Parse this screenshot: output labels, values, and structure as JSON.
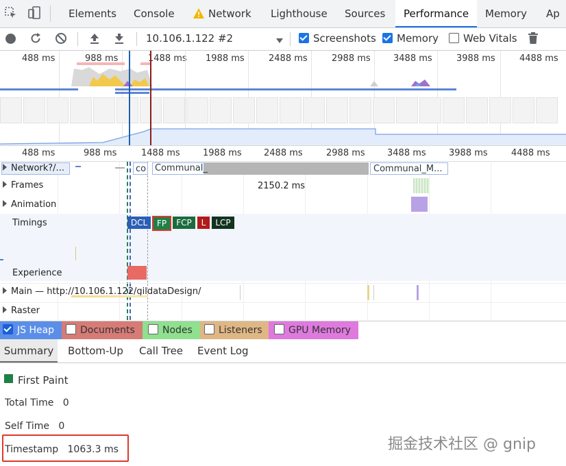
{
  "tabs": [
    "Elements",
    "Console",
    "Network",
    "Lighthouse",
    "Sources",
    "Performance",
    "Memory",
    "Ap"
  ],
  "active_tab": "Performance",
  "toolbar": {
    "profile_select": "10.106.1.122 #2",
    "screenshots_label": "Screenshots",
    "memory_label": "Memory",
    "web_vitals_label": "Web Vitals"
  },
  "overview_ticks": [
    "488 ms",
    "988 ms",
    "1488 ms",
    "1988 ms",
    "2488 ms",
    "2988 ms",
    "3488 ms",
    "3988 ms",
    "4488 ms"
  ],
  "ruler_ticks": [
    "488 ms",
    "988 ms",
    "1488 ms",
    "1988 ms",
    "2488 ms",
    "2988 ms",
    "3488 ms",
    "3988 ms",
    "4488 ms"
  ],
  "tracks": {
    "network": "Network",
    "network_suffix": "?/...",
    "network_items": [
      "co",
      "Communal_",
      "Communal_M..."
    ],
    "frames": "Frames",
    "frame_duration": "2150.2 ms",
    "animation": "Animation",
    "timings": "Timings",
    "timing_marks": [
      "DCL",
      "FP",
      "FCP",
      "L",
      "LCP"
    ],
    "experience": "Experience",
    "main": "Main — http://10.106.1.122/gildataDesign/",
    "raster": "Raster"
  },
  "counters": [
    "JS Heap",
    "Documents",
    "Nodes",
    "Listeners",
    "GPU Memory"
  ],
  "counter_colors": [
    "#4285f4",
    "#d9605a",
    "#6acb6a",
    "#d9a566",
    "#d45fd4"
  ],
  "subtabs": [
    "Summary",
    "Bottom-Up",
    "Call Tree",
    "Event Log"
  ],
  "summary": {
    "title": "First Paint",
    "total_time_label": "Total Time",
    "total_time_value": "0",
    "self_time_label": "Self Time",
    "self_time_value": "0",
    "timestamp_label": "Timestamp",
    "timestamp_value": "1063.3 ms"
  },
  "watermark": "掘金技术社区 @ gnip"
}
